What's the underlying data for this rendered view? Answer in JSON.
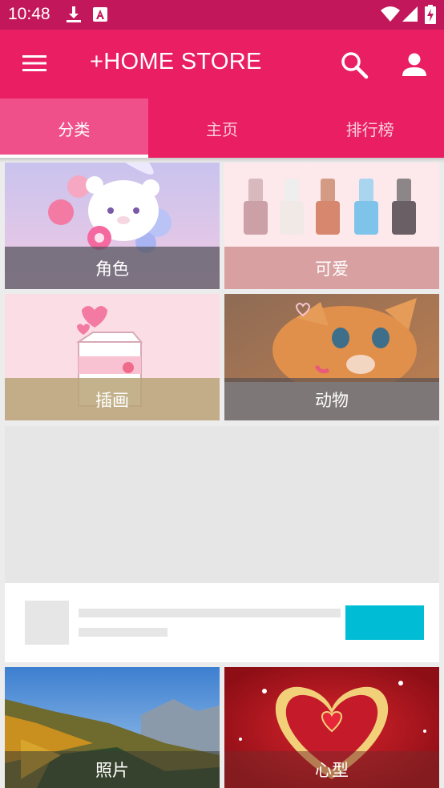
{
  "status_bar": {
    "time": "10:48",
    "icons": [
      "download-icon",
      "a-icon",
      "wifi-icon",
      "signal-icon",
      "battery-icon"
    ]
  },
  "app_bar": {
    "title": "+HOME STORE",
    "background": "#e91e63",
    "icons": [
      "menu-icon",
      "search-icon",
      "account-icon"
    ]
  },
  "tabs": [
    {
      "label": "分类",
      "active": true
    },
    {
      "label": "主页",
      "active": false
    },
    {
      "label": "排行榜",
      "active": false
    }
  ],
  "categories": [
    {
      "label": "角色"
    },
    {
      "label": "可爱"
    },
    {
      "label": "插画"
    },
    {
      "label": "动物"
    },
    {
      "label": "照片"
    },
    {
      "label": "心型"
    }
  ],
  "ad": {
    "button_color": "#00bcd4"
  }
}
